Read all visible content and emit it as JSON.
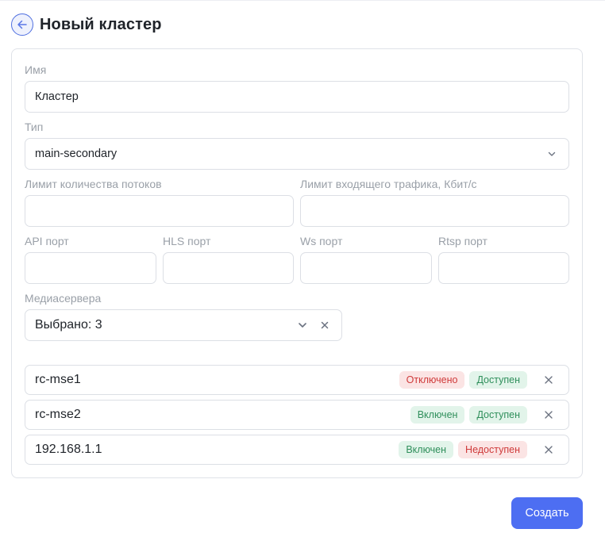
{
  "header": {
    "title": "Новый кластер",
    "back_icon": "arrow-left-icon"
  },
  "form": {
    "name_label": "Имя",
    "name_value": "Кластер",
    "type_label": "Тип",
    "type_value": "main-secondary",
    "streams_limit_label": "Лимит количества потоков",
    "streams_limit_value": "",
    "traffic_limit_label": "Лимит входящего трафика, Кбит/с",
    "traffic_limit_value": "",
    "api_port_label": "API порт",
    "api_port_value": "",
    "hls_port_label": "HLS порт",
    "hls_port_value": "",
    "ws_port_label": "Ws порт",
    "ws_port_value": "",
    "rtsp_port_label": "Rtsp порт",
    "rtsp_port_value": "",
    "mediaservers_label": "Медиасервера",
    "mediaservers_value": "Выбрано: 3"
  },
  "servers": [
    {
      "name": "rc-mse1",
      "state": "Отключено",
      "state_color": "red",
      "availability": "Доступен",
      "availability_color": "green"
    },
    {
      "name": "rc-mse2",
      "state": "Включен",
      "state_color": "green",
      "availability": "Доступен",
      "availability_color": "green"
    },
    {
      "name": "192.168.1.1",
      "state": "Включен",
      "state_color": "green",
      "availability": "Недоступен",
      "availability_color": "red"
    }
  ],
  "actions": {
    "create_label": "Создать"
  },
  "colors": {
    "accent": "#4d6ef2",
    "green_text": "#2f8f5b",
    "green_bg": "#e2f4ea",
    "red_text": "#cf3a3a",
    "red_bg": "#fbe4e4"
  }
}
